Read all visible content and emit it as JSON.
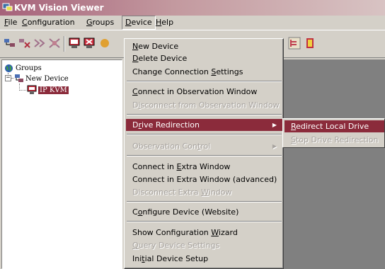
{
  "window": {
    "title": "KVM Vision Viewer"
  },
  "menubar": {
    "items": [
      {
        "pre": "",
        "key": "F",
        "post": "ile"
      },
      {
        "pre": "",
        "key": "C",
        "post": "onfiguration"
      },
      {
        "pre": "",
        "key": "G",
        "post": "roups"
      },
      {
        "pre": "",
        "key": "D",
        "post": "evice"
      },
      {
        "pre": "",
        "key": "H",
        "post": "elp"
      }
    ],
    "open_menu": "Device"
  },
  "toolbar": {
    "icons": [
      "group-add-icon",
      "group-delete-icon",
      "group-connect-icon",
      "group-disconnect-icon",
      "device-monitor-icon",
      "device-remove-icon",
      "device-settings-icon",
      "tree-view-icon",
      "exit-icon"
    ]
  },
  "tree": {
    "root": "Groups",
    "group": "New Device",
    "device": "IP KVM",
    "expander": "−"
  },
  "device_menu": {
    "items": [
      {
        "pre": "",
        "key": "N",
        "post": "ew Device",
        "enabled": true
      },
      {
        "pre": "",
        "key": "D",
        "post": "elete Device",
        "enabled": true
      },
      {
        "pre": "Change Connection ",
        "key": "S",
        "post": "ettings",
        "enabled": true
      },
      {
        "pre": "",
        "key": "C",
        "post": "onnect in Observation Window",
        "enabled": true
      },
      {
        "pre": "D",
        "key": "i",
        "post": "sconnect from Observation Window",
        "enabled": false
      },
      {
        "pre": "D",
        "key": "r",
        "post": "ive Redirection",
        "enabled": true,
        "highlighted": true,
        "submenu": true
      },
      {
        "pre": "Observation Con",
        "key": "t",
        "post": "rol",
        "enabled": false,
        "submenu": true
      },
      {
        "pre": "Connect in ",
        "key": "E",
        "post": "xtra Window",
        "enabled": true
      },
      {
        "pre": "Connect in Extra Window (advanced)",
        "key": "",
        "post": "",
        "enabled": true
      },
      {
        "pre": "Disconnect Extra ",
        "key": "W",
        "post": "indow",
        "enabled": false
      },
      {
        "pre": "C",
        "key": "o",
        "post": "nfigure Device (Website)",
        "enabled": true
      },
      {
        "pre": "Show Configuration ",
        "key": "W",
        "post": "izard",
        "enabled": true
      },
      {
        "pre": "",
        "key": "Q",
        "post": "uery Device Settings",
        "enabled": false
      },
      {
        "pre": "Ini",
        "key": "t",
        "post": "ial Device Setup",
        "enabled": true
      }
    ]
  },
  "drive_submenu": {
    "items": [
      {
        "pre": "",
        "key": "R",
        "post": "edirect Local Drive",
        "enabled": true,
        "highlighted": true
      },
      {
        "pre": "",
        "key": "S",
        "post": "top Drive Redirection",
        "enabled": false
      }
    ]
  }
}
